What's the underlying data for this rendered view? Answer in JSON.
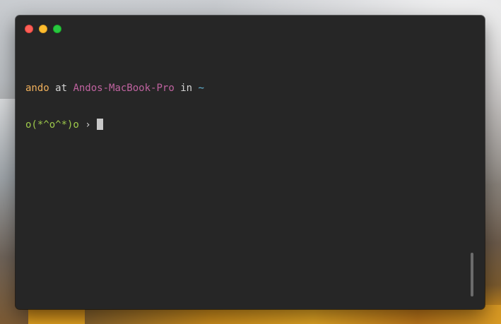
{
  "window": {
    "buttons": {
      "close_color": "#fe5f57",
      "minimize_color": "#febc2e",
      "maximize_color": "#28c840"
    }
  },
  "terminal": {
    "line1": {
      "user": "ando",
      "at": "at",
      "host": "Andos-MacBook-Pro",
      "in": "in",
      "path": "~"
    },
    "line2": {
      "prompt_face": "o(*^o^*)o",
      "prompt_symbol": "›"
    },
    "colors": {
      "background": "#262626",
      "user": "#f0b05b",
      "host": "#c063a0",
      "path": "#63b6d6",
      "prompt_face": "#9ec94b"
    }
  }
}
